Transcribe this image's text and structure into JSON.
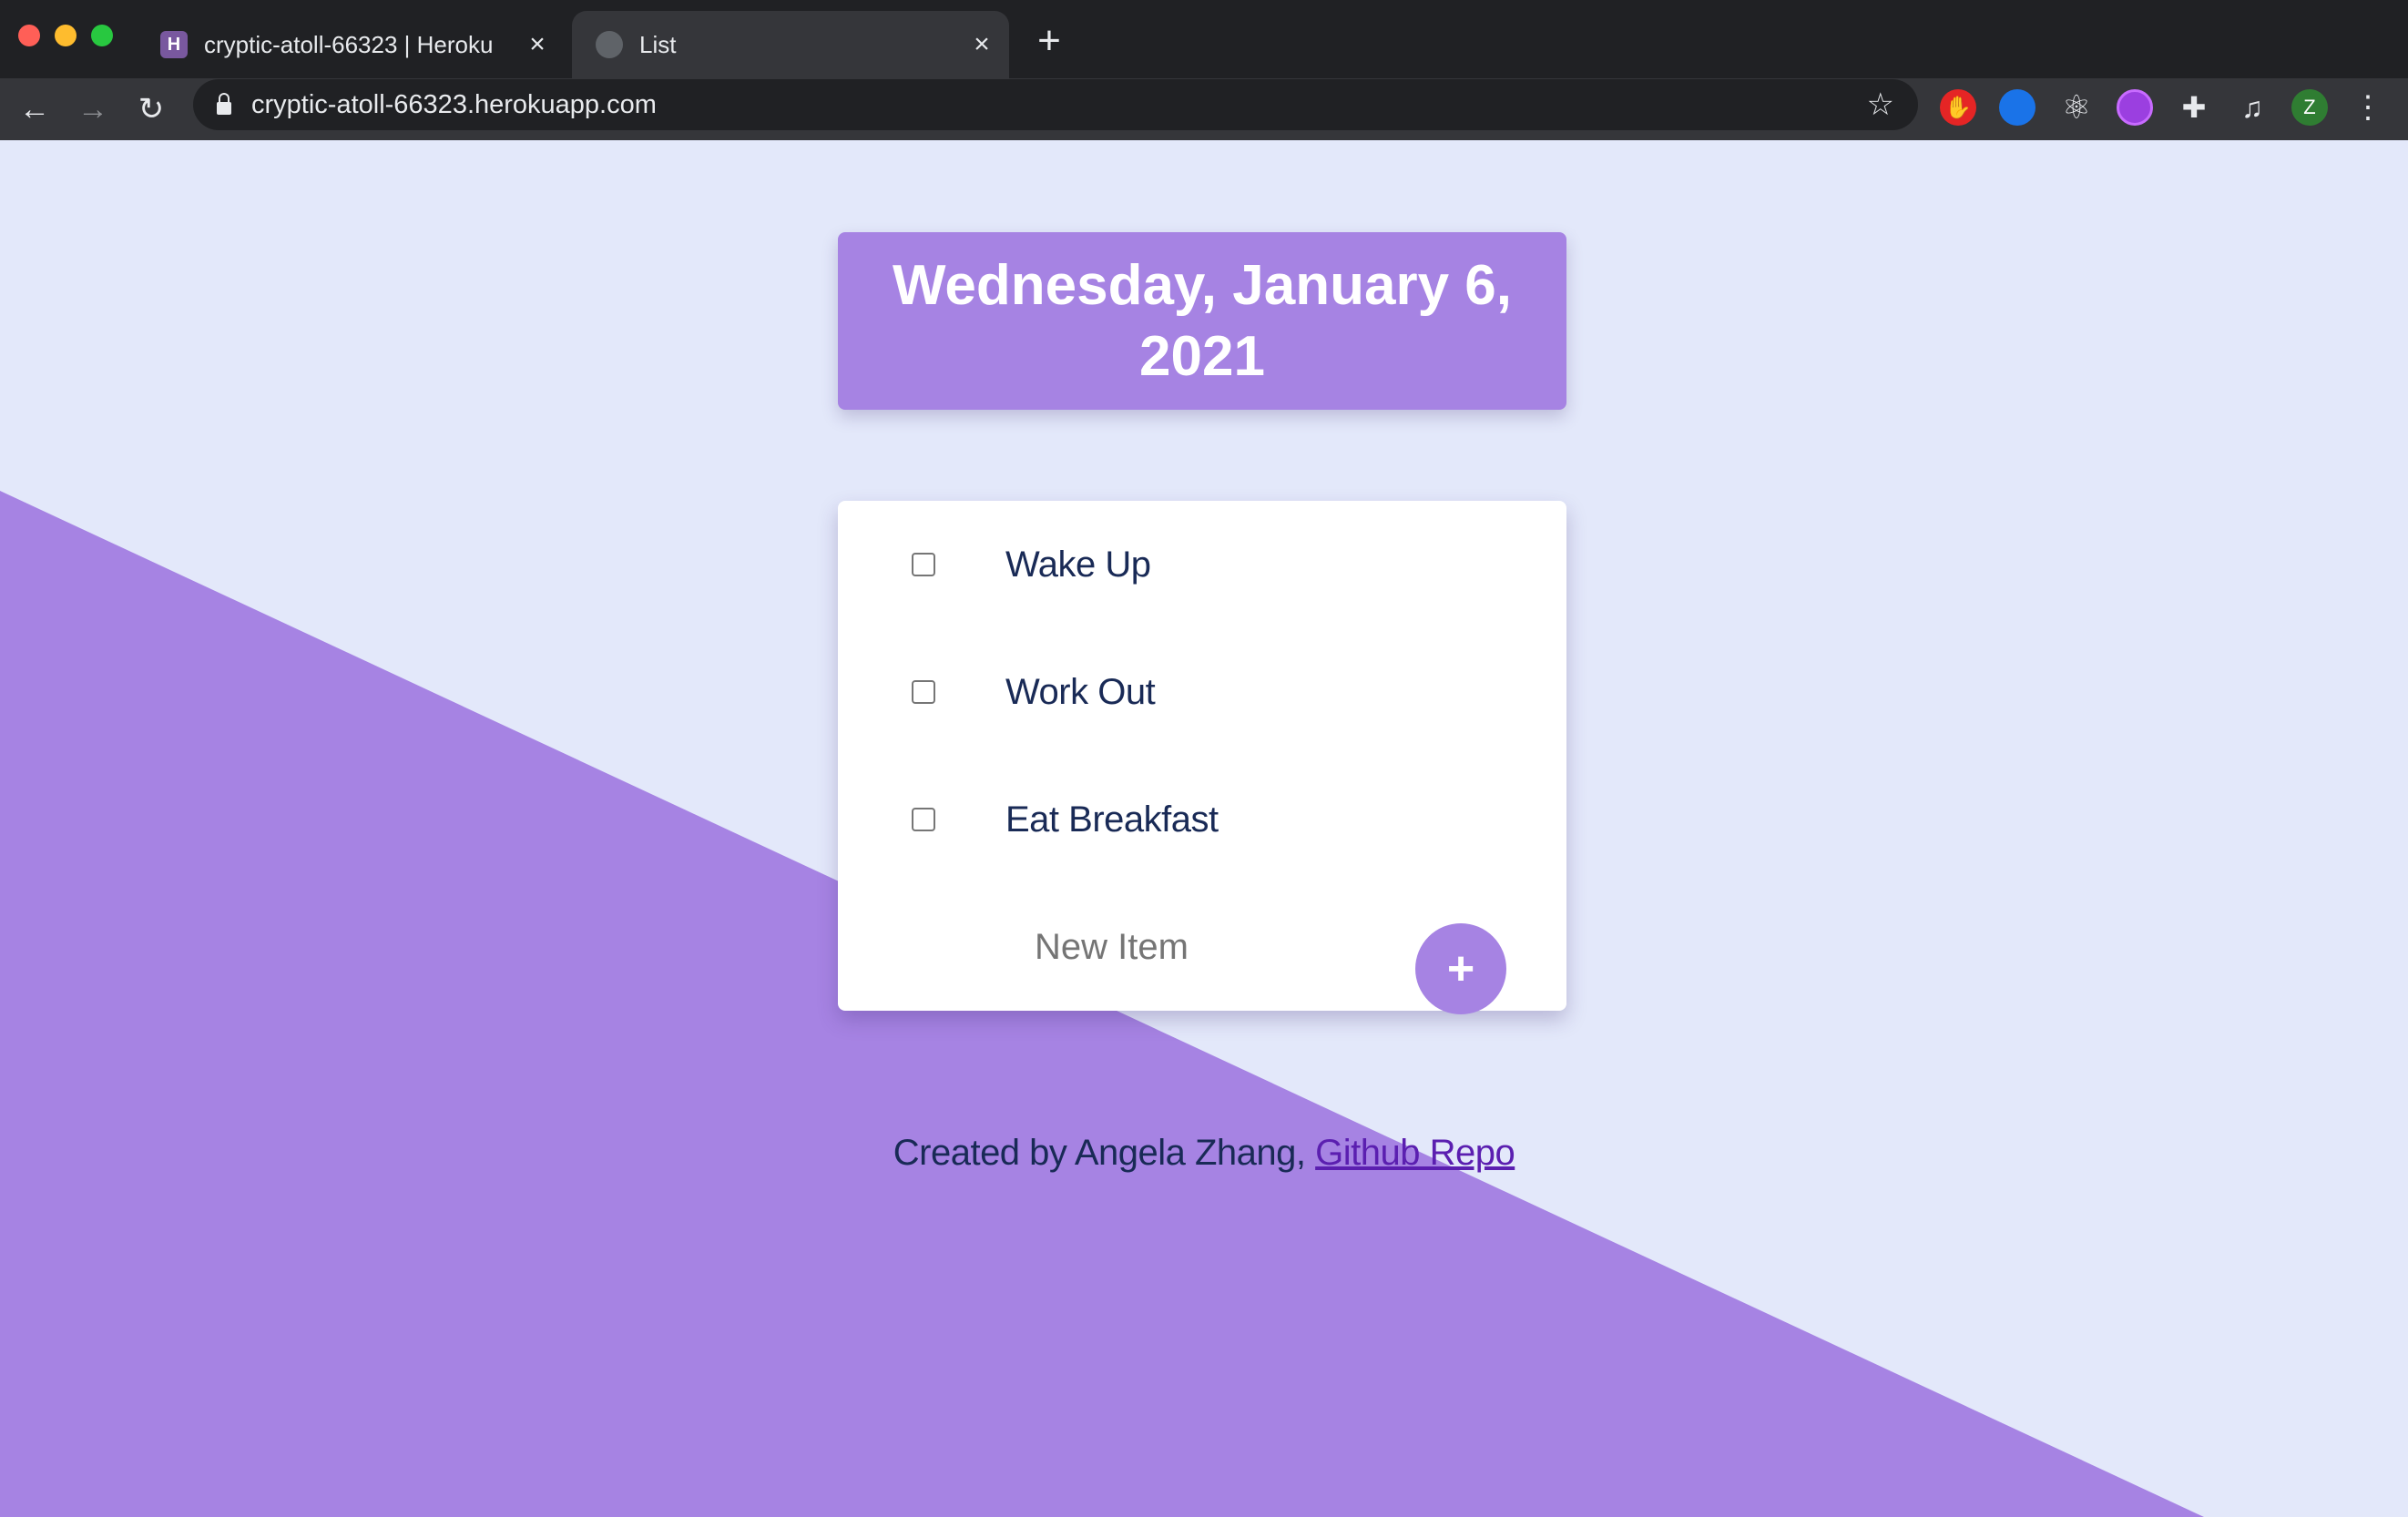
{
  "browser": {
    "tabs": [
      {
        "title": "cryptic-atoll-66323 | Heroku",
        "favicon": "heroku-icon",
        "active": false
      },
      {
        "title": "List",
        "favicon": "globe-icon",
        "active": true
      }
    ],
    "url": "cryptic-atoll-66323.herokuapp.com",
    "avatar_letter": "Z",
    "icons": {
      "close": "×",
      "new_tab": "+",
      "back": "←",
      "forward": "→",
      "reload": "↻",
      "star": "☆",
      "menu": "⋮"
    }
  },
  "page": {
    "date": "Wednesday, January 6, 2021",
    "items": [
      {
        "label": "Wake Up",
        "checked": false
      },
      {
        "label": "Work Out",
        "checked": false
      },
      {
        "label": "Eat Breakfast",
        "checked": false
      }
    ],
    "new_item_placeholder": "New Item",
    "add_button_label": "+",
    "footer_text": "Created by Angela Zhang, ",
    "footer_link": "Github Repo"
  },
  "colors": {
    "accent": "#a683e3",
    "background": "#e3e8fa",
    "text": "#192a56",
    "link": "#5b1fb0"
  }
}
